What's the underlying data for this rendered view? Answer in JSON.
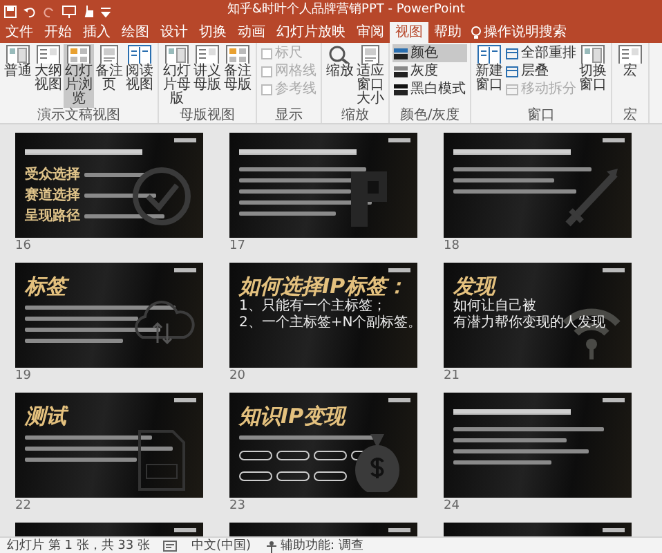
{
  "window": {
    "title": "知乎&时叶个人品牌营销PPT - PowerPoint"
  },
  "tabs": [
    {
      "label": "文件",
      "selected": false
    },
    {
      "label": "开始",
      "selected": false
    },
    {
      "label": "插入",
      "selected": false
    },
    {
      "label": "绘图",
      "selected": false
    },
    {
      "label": "设计",
      "selected": false
    },
    {
      "label": "切换",
      "selected": false
    },
    {
      "label": "动画",
      "selected": false
    },
    {
      "label": "幻灯片放映",
      "selected": false
    },
    {
      "label": "审阅",
      "selected": false
    },
    {
      "label": "视图",
      "selected": true
    },
    {
      "label": "帮助",
      "selected": false
    }
  ],
  "search": {
    "placeholder": "操作说明搜索"
  },
  "ribbon": [
    {
      "label": "演示文稿视图",
      "items": [
        {
          "kind": "large",
          "label": "普通",
          "selected": false
        },
        {
          "kind": "large",
          "label": "大纲视图",
          "selected": false
        },
        {
          "kind": "large",
          "label": "幻灯片浏览",
          "selected": true
        },
        {
          "kind": "large",
          "label": "备注页",
          "selected": false
        },
        {
          "kind": "large",
          "label": "阅读视图",
          "selected": false
        }
      ]
    },
    {
      "label": "母版视图",
      "items": [
        {
          "kind": "large",
          "label": "幻灯片母版",
          "selected": false
        },
        {
          "kind": "large",
          "label": "讲义母版",
          "selected": false
        },
        {
          "kind": "large",
          "label": "备注母版",
          "selected": false
        }
      ]
    },
    {
      "label": "显示",
      "items": [
        {
          "kind": "check",
          "label": "标尺",
          "checked": false,
          "disabled": true
        },
        {
          "kind": "check",
          "label": "网格线",
          "checked": false,
          "disabled": true
        },
        {
          "kind": "check",
          "label": "参考线",
          "checked": false,
          "disabled": true
        }
      ]
    },
    {
      "label": "缩放",
      "items": [
        {
          "kind": "large",
          "label": "缩放",
          "selected": false
        },
        {
          "kind": "large",
          "label": "适应窗口大小",
          "selected": false
        }
      ]
    },
    {
      "label": "颜色/灰度",
      "items": [
        {
          "kind": "swatch",
          "label": "颜色",
          "selected": true
        },
        {
          "kind": "swatch",
          "label": "灰度",
          "selected": false
        },
        {
          "kind": "swatch",
          "label": "黑白模式",
          "selected": false
        }
      ]
    },
    {
      "label": "窗口",
      "items": [
        {
          "kind": "large",
          "label": "新建窗口",
          "selected": false
        },
        {
          "kind": "small",
          "label": "全部重排",
          "disabled": false
        },
        {
          "kind": "small",
          "label": "层叠",
          "disabled": false
        },
        {
          "kind": "small",
          "label": "移动拆分",
          "disabled": true
        },
        {
          "kind": "large",
          "label": "切换窗口",
          "selected": false
        }
      ]
    },
    {
      "label": "宏",
      "items": [
        {
          "kind": "large",
          "label": "宏",
          "selected": false
        }
      ]
    }
  ],
  "slides": [
    {
      "number": "16",
      "lines": [
        {
          "kind": "blurred"
        },
        {
          "kind": "labeled",
          "label": "受众选择"
        },
        {
          "kind": "labeled",
          "label": "赛道选择"
        },
        {
          "kind": "labeled",
          "label": "呈现路径"
        }
      ]
    },
    {
      "number": "17",
      "lines": [
        {
          "kind": "blurred"
        },
        {
          "kind": "bullet"
        },
        {
          "kind": "bullet"
        },
        {
          "kind": "bullet"
        },
        {
          "kind": "bullet"
        },
        {
          "kind": "bullet"
        }
      ]
    },
    {
      "number": "18",
      "lines": [
        {
          "kind": "blurred"
        },
        {
          "kind": "bullet"
        },
        {
          "kind": "bullet"
        },
        {
          "kind": "bullet"
        }
      ]
    },
    {
      "number": "19",
      "lines": [
        {
          "kind": "heading",
          "text": "标签"
        },
        {
          "kind": "bullet"
        },
        {
          "kind": "bullet"
        },
        {
          "kind": "bullet"
        },
        {
          "kind": "bullet"
        }
      ]
    },
    {
      "number": "20",
      "lines": [
        {
          "kind": "heading",
          "text": "如何选择IP标签："
        },
        {
          "kind": "text",
          "text": "1、只能有一个主标签；"
        },
        {
          "kind": "text",
          "text": "2、一个主标签+N个副标签。"
        }
      ]
    },
    {
      "number": "21",
      "lines": [
        {
          "kind": "heading",
          "text": "发现"
        },
        {
          "kind": "text",
          "text": "如何让自己被"
        },
        {
          "kind": "text",
          "text": "有潜力帮你变现的人发现"
        }
      ]
    },
    {
      "number": "22",
      "lines": [
        {
          "kind": "heading",
          "text": "测试"
        },
        {
          "kind": "bullet"
        },
        {
          "kind": "bullet"
        },
        {
          "kind": "bullet"
        }
      ]
    },
    {
      "number": "23",
      "lines": [
        {
          "kind": "heading",
          "text": "知识IP变现"
        },
        {
          "kind": "bullet"
        },
        {
          "kind": "pills"
        }
      ]
    },
    {
      "number": "24",
      "lines": [
        {
          "kind": "blurred"
        },
        {
          "kind": "bullet"
        },
        {
          "kind": "bullet"
        },
        {
          "kind": "bullet"
        },
        {
          "kind": "bullet"
        }
      ]
    },
    {
      "kind": "cut"
    },
    {
      "kind": "cut"
    },
    {
      "kind": "cut"
    }
  ],
  "status_bar": [
    {
      "kind": "text",
      "text": "幻灯片 第 1 张，共 33 张"
    },
    {
      "kind": "notes"
    },
    {
      "kind": "text",
      "text": "中文(中国)"
    },
    {
      "kind": "accessibility",
      "text": "辅助功能: 调查"
    }
  ]
}
